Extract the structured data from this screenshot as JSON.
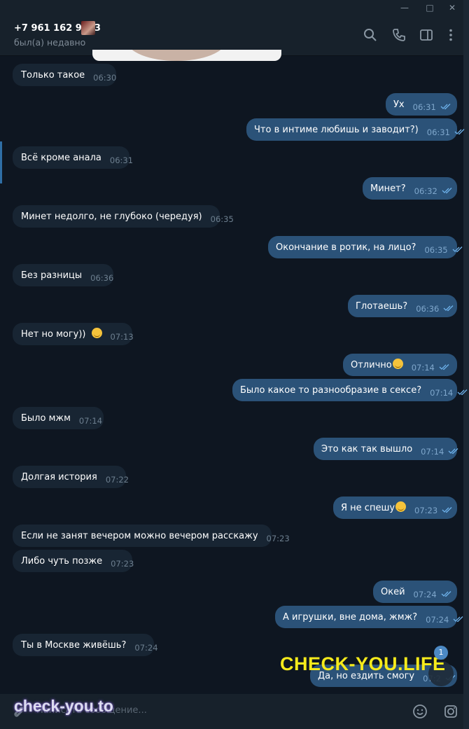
{
  "header": {
    "contact_name": "+7 961 162 9373",
    "status": "был(а) недавно"
  },
  "messages": [
    {
      "side": "in",
      "text": "Только такое",
      "time": "06:30"
    },
    {
      "side": "out",
      "text": "Ух",
      "time": "06:31"
    },
    {
      "side": "out",
      "text": "Что в интиме любишь и заводит?)",
      "time": "06:31"
    },
    {
      "side": "in",
      "text": "Всё кроме анала",
      "time": "06:31"
    },
    {
      "side": "out",
      "text": "Минет?",
      "time": "06:32"
    },
    {
      "side": "in",
      "text": "Минет недолго, не глубоко (чередуя)",
      "time": "06:35"
    },
    {
      "side": "out",
      "text": "Окончание в ротик, на лицо?",
      "time": "06:35"
    },
    {
      "side": "in",
      "text": "Без разницы",
      "time": "06:36"
    },
    {
      "side": "out",
      "text": "Глотаешь?",
      "time": "06:36"
    },
    {
      "side": "in",
      "text": "Нет но могу))",
      "time": "07:13",
      "emoji": "smirk-emoji"
    },
    {
      "side": "out",
      "text": "Отлично",
      "time": "07:14",
      "emoji": "smirk-emoji"
    },
    {
      "side": "out",
      "text": "Было какое то разнообразие в сексе?",
      "time": "07:14"
    },
    {
      "side": "in",
      "text": "Было мжм",
      "time": "07:14"
    },
    {
      "side": "out",
      "text": "Это как так вышло",
      "time": "07:14"
    },
    {
      "side": "in",
      "text": "Долгая история",
      "time": "07:22"
    },
    {
      "side": "out",
      "text": "Я не спешу",
      "time": "07:23",
      "emoji": "sweat-smile-emoji"
    },
    {
      "side": "in",
      "text": "Если не занят вечером можно вечером расскажу",
      "time": "07:23"
    },
    {
      "side": "in",
      "text": "Либо чуть позже",
      "time": "07:23"
    },
    {
      "side": "out",
      "text": "Окей",
      "time": "07:24"
    },
    {
      "side": "out",
      "text": "А игрушки, вне дома, жмж?",
      "time": "07:24"
    },
    {
      "side": "in",
      "text": "Ты в Москве живёшь?",
      "time": "07:24"
    },
    {
      "side": "out",
      "text": "Да, но ездить смогу",
      "time": "07:2"
    }
  ],
  "unread_badge": "1",
  "composer": {
    "placeholder": "Написать сообщение..."
  },
  "watermarks": {
    "top": "CHECK-YOU.LIFE",
    "bottom": "check-you.to"
  },
  "colors": {
    "background": "#0e1621",
    "header": "#17212b",
    "incoming_bubble": "#182533",
    "outgoing_bubble": "#2b5278",
    "accent": "#4c89c4",
    "watermark_yellow": "#f5ea1b"
  },
  "icons": [
    "search-icon",
    "phone-icon",
    "sidebar-toggle-icon",
    "more-vert-icon",
    "attach-icon",
    "emoji-icon",
    "instagram-icon",
    "double-check-icon"
  ]
}
